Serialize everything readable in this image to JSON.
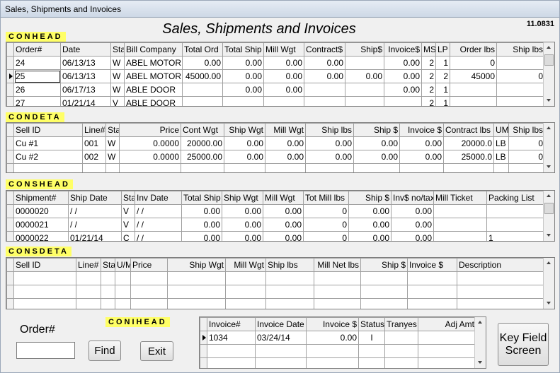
{
  "window": {
    "title": "Sales, Shipments and Invoices"
  },
  "header": {
    "title": "Sales, Shipments and Invoices",
    "version": "11.0831"
  },
  "sections": {
    "conhead": "CONHEAD",
    "condeta": "CONDETA",
    "conshead": "CONSHEAD",
    "consdeta": "CONSDETA",
    "conihead": "CONIHEAD"
  },
  "conhead": {
    "columns": [
      "Order#",
      "Date",
      "Sta",
      "Bill Company",
      "Total Ord",
      "Total Ship",
      "Mill Wgt",
      "Contract$",
      "Ship$",
      "Invoice$",
      "MS",
      "LP",
      "Order lbs",
      "Ship lbs"
    ],
    "rows": [
      [
        "24",
        "06/13/13",
        "W",
        "ABEL MOTOR",
        "0.00",
        "0.00",
        "0.00",
        "0.00",
        "",
        "0.00",
        "2",
        "1",
        "0",
        ""
      ],
      [
        "25",
        "06/13/13",
        "W",
        "ABEL MOTOR",
        "45000.00",
        "0.00",
        "0.00",
        "0.00",
        "0.00",
        "0.00",
        "2",
        "2",
        "45000",
        "0"
      ],
      [
        "26",
        "06/17/13",
        "W",
        "ABLE DOOR",
        "",
        "0.00",
        "0.00",
        "",
        "",
        "0.00",
        "2",
        "1",
        "",
        ""
      ],
      [
        "27",
        "01/21/14",
        "V",
        "ABLE DOOR",
        "",
        "",
        "",
        "",
        "",
        "",
        "2",
        "1",
        "",
        ""
      ]
    ]
  },
  "condeta": {
    "columns": [
      "Sell ID",
      "Line#",
      "Sta",
      "Price",
      "Cont Wgt",
      "Ship Wgt",
      "Mill Wgt",
      "Ship lbs",
      "Ship $",
      "Invoice $",
      "Contract lbs",
      "UM",
      "Ship lbs"
    ],
    "rows": [
      [
        "Cu #1",
        "001",
        "W",
        "0.0000",
        "20000.00",
        "0.00",
        "0.00",
        "0.00",
        "0.00",
        "0.00",
        "20000.0",
        "LB",
        "0"
      ],
      [
        "Cu #2",
        "002",
        "W",
        "0.0000",
        "25000.00",
        "0.00",
        "0.00",
        "0.00",
        "0.00",
        "0.00",
        "25000.0",
        "LB",
        "0"
      ]
    ]
  },
  "conshead": {
    "columns": [
      "Shipment#",
      "Ship Date",
      "Sta",
      "Inv Date",
      "Total Ship",
      "Ship Wgt",
      "Mill Wgt",
      "Tot Mill lbs",
      "Ship $",
      "Inv$ no/tax",
      "Mill Ticket",
      "Packing List"
    ],
    "rows": [
      [
        "0000020",
        "/ /",
        "V",
        "/ /",
        "0.00",
        "0.00",
        "0.00",
        "0",
        "0.00",
        "0.00",
        "",
        ""
      ],
      [
        "0000021",
        "/ /",
        "V",
        "/ /",
        "0.00",
        "0.00",
        "0.00",
        "0",
        "0.00",
        "0.00",
        "",
        ""
      ],
      [
        "0000022",
        "01/21/14",
        "C",
        "/ /",
        "0.00",
        "0.00",
        "0.00",
        "0",
        "0.00",
        "0.00",
        "",
        "1"
      ]
    ]
  },
  "consdeta": {
    "columns": [
      "Sell ID",
      "Line#",
      "Sta",
      "U/M",
      "Price",
      "Ship Wgt",
      "Mill Wgt",
      "Ship lbs",
      "Mill Net lbs",
      "Ship $",
      "Invoice $",
      "Description"
    ]
  },
  "conihead": {
    "columns": [
      "Invoice#",
      "Invoice Date",
      "Invoice $",
      "Status",
      "Tranyes",
      "Adj Amt"
    ],
    "rows": [
      [
        "1034",
        "03/24/14",
        "0.00",
        "I",
        "",
        ""
      ]
    ]
  },
  "search": {
    "label": "Order#",
    "value": ""
  },
  "buttons": {
    "find": "Find",
    "exit": "Exit",
    "key_field_screen": "Key Field Screen"
  }
}
